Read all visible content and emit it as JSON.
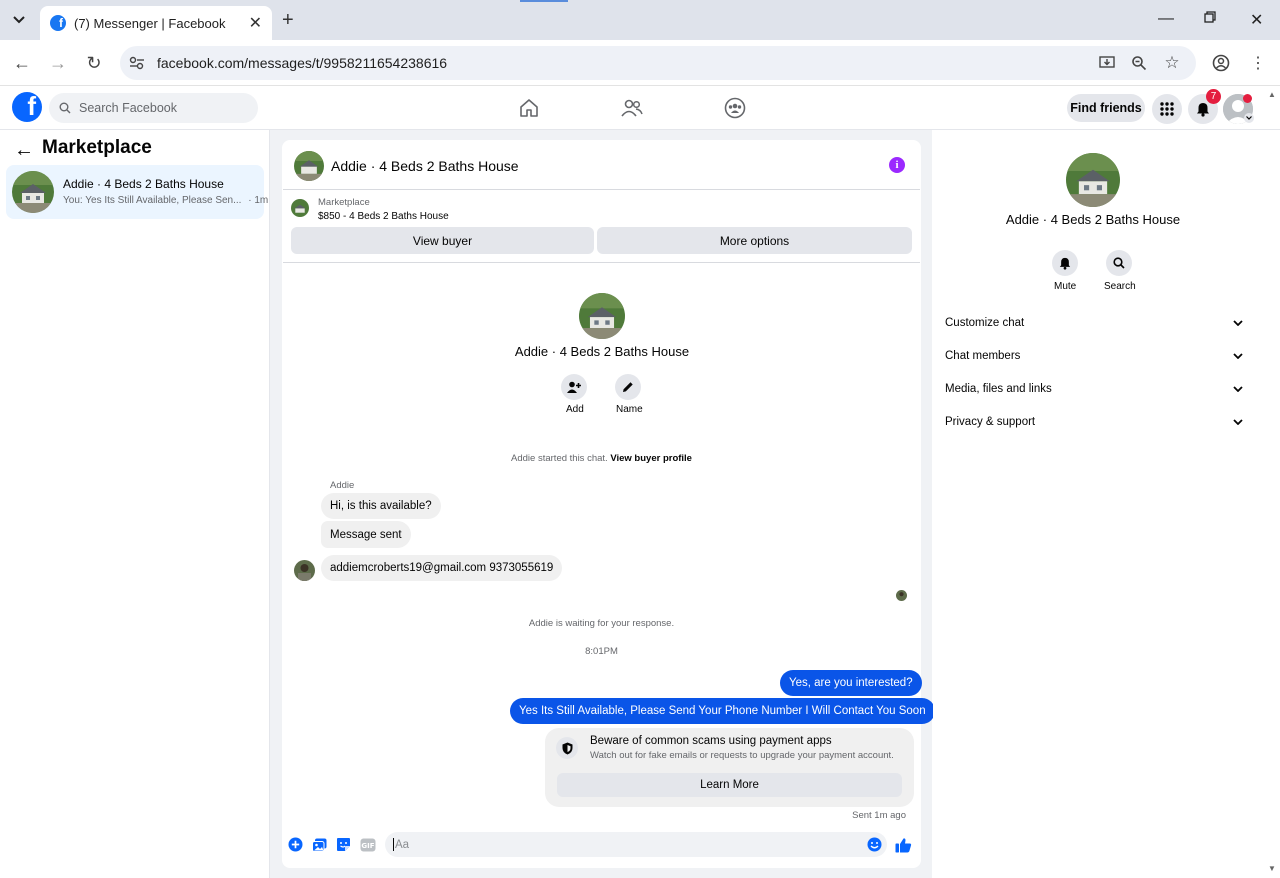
{
  "browser": {
    "tab_title": "(7) Messenger | Facebook",
    "url": "facebook.com/messages/t/9958211654238616"
  },
  "fb_nav": {
    "search_placeholder": "Search Facebook",
    "find_friends": "Find friends",
    "notifications_count": "7"
  },
  "left_panel": {
    "title": "Marketplace",
    "thread": {
      "name": "Addie · 4 Beds 2 Baths House",
      "preview": "You: Yes Its Still Available, Please Sen...",
      "time": "· 1m"
    }
  },
  "conversation": {
    "header_name": "Addie · 4 Beds 2 Baths House",
    "marketplace_label": "Marketplace",
    "listing": "$850 - 4 Beds 2 Baths House",
    "view_buyer": "View buyer",
    "more_options": "More options",
    "profile_name": "Addie · 4 Beds 2 Baths House",
    "add_label": "Add",
    "name_label": "Name",
    "started_text": "Addie started this chat.",
    "view_buyer_profile": "View buyer profile",
    "sender_name": "Addie",
    "incoming": [
      "Hi, is this available?",
      "Message sent",
      "addiemcroberts19@gmail.com 9373055619"
    ],
    "waiting_text": "Addie is waiting for your response.",
    "timestamp": "8:01PM",
    "outgoing": [
      "Yes, are you interested?",
      "Yes Its Still Available, Please Send Your Phone Number I Will Contact You Soon"
    ],
    "scam_title": "Beware of common scams using payment apps",
    "scam_subtitle": "Watch out for fake emails or requests to upgrade your payment account.",
    "learn_more": "Learn More",
    "sent_ago": "Sent 1m ago",
    "composer_placeholder": "Aa"
  },
  "right_panel": {
    "name": "Addie · 4 Beds 2 Baths House",
    "mute": "Mute",
    "search": "Search",
    "sections": [
      "Customize chat",
      "Chat members",
      "Media, files and links",
      "Privacy & support"
    ]
  },
  "colors": {
    "fb_blue": "#0866ff",
    "outgoing_bubble": "#0a55e8",
    "info_purple": "#9b29ff",
    "badge_red": "#e41e3f"
  }
}
